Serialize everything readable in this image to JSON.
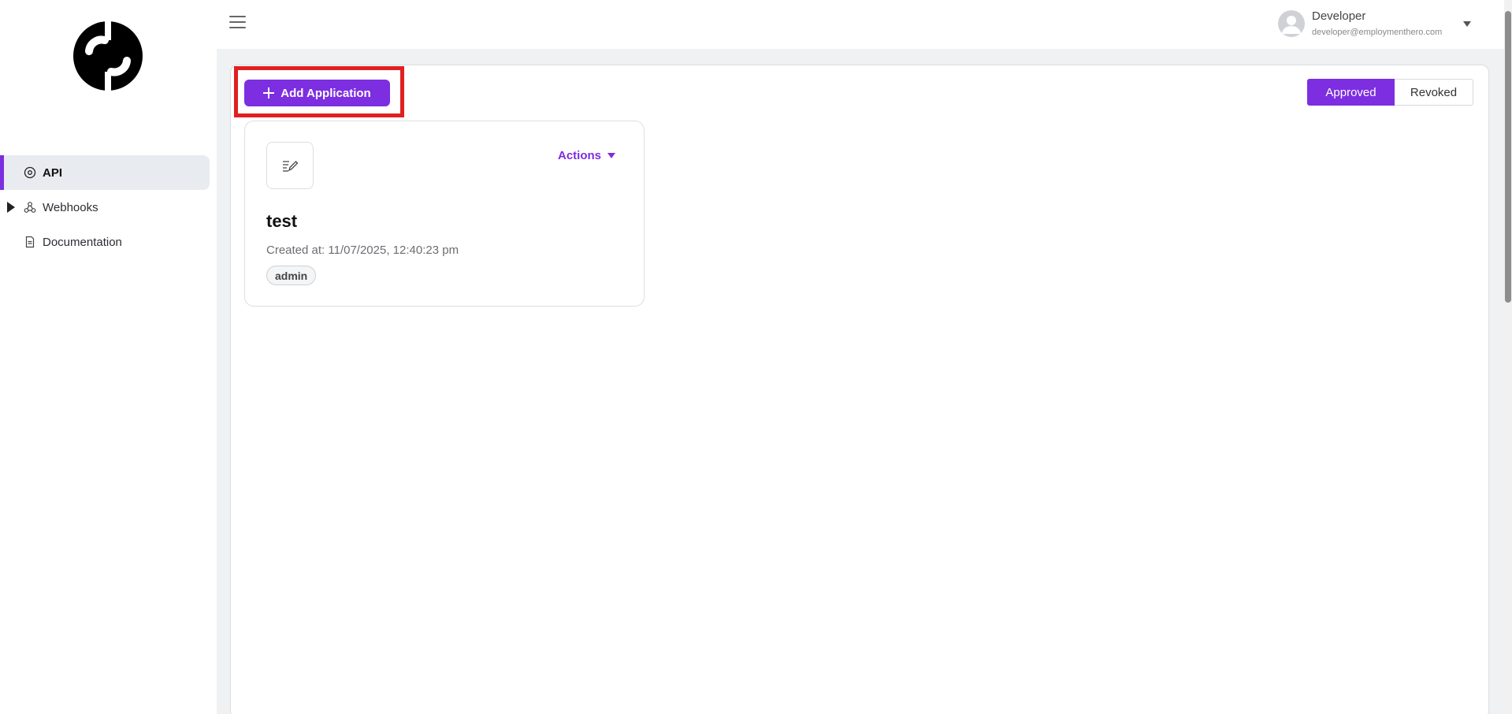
{
  "sidebar": {
    "logo_icon": "employment-hero-logo-icon",
    "items": [
      {
        "label": "API",
        "icon": "api-icon",
        "active": true
      },
      {
        "label": "Webhooks",
        "icon": "webhooks-icon",
        "expandable": true
      },
      {
        "label": "Documentation",
        "icon": "document-icon"
      }
    ]
  },
  "topbar": {
    "menu_icon": "hamburger-menu-icon",
    "user": {
      "name": "Developer",
      "email": "developer@employmenthero.com",
      "avatar_icon": "user-avatar-icon",
      "caret_icon": "chevron-down-icon"
    }
  },
  "toolbar": {
    "add_label": "Add Application",
    "filters": [
      "Approved",
      "Revoked"
    ],
    "active_filter": "Approved"
  },
  "applications": [
    {
      "name": "test",
      "created": "Created at: 11/07/2025, 12:40:23 pm",
      "tag": "admin",
      "actions_label": "Actions",
      "icon": "edit-note-icon"
    }
  ],
  "colors": {
    "accent": "#7c2ee0",
    "highlight": "#e02020",
    "background": "#f0f1f3"
  }
}
